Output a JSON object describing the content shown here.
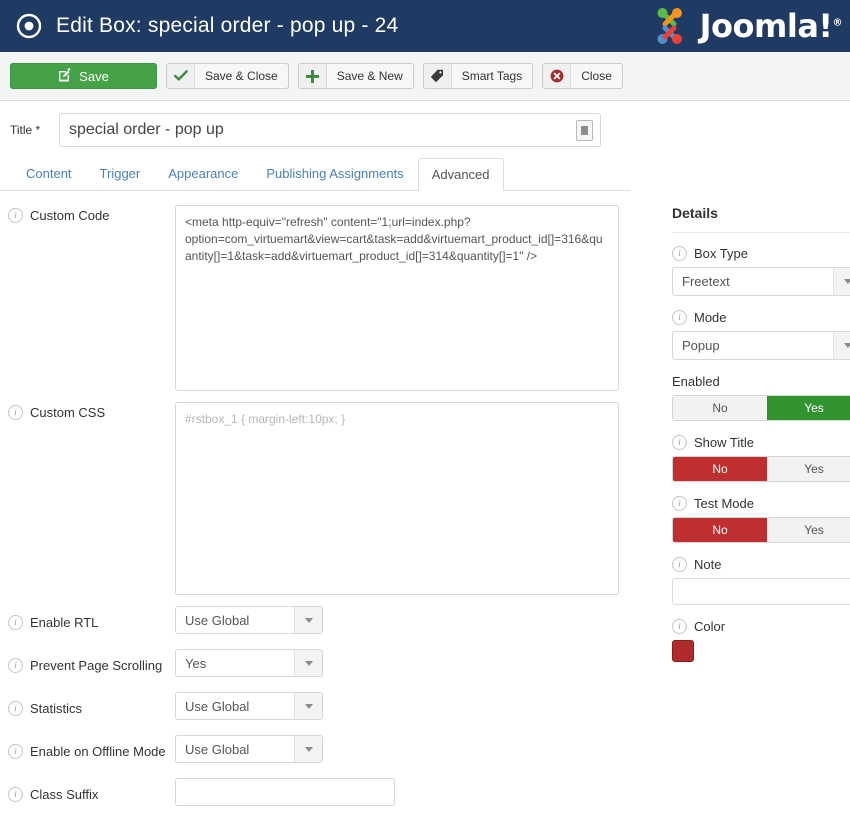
{
  "header": {
    "icon": "target-icon",
    "title": "Edit Box: special order - pop up - 24",
    "brand": "Joomla!",
    "brand_reg": "®",
    "bg_color": "#1f3a63"
  },
  "toolbar": {
    "buttons": [
      {
        "label": "Save",
        "icon": "pencil-square-icon",
        "style": "primary-green"
      },
      {
        "label": "Save & Close",
        "icon": "check-icon",
        "style": "default"
      },
      {
        "label": "Save & New",
        "icon": "plus-icon",
        "style": "default"
      },
      {
        "label": "Smart Tags",
        "icon": "tag-icon",
        "style": "default"
      },
      {
        "label": "Close",
        "icon": "circle-x-icon",
        "style": "default"
      }
    ]
  },
  "title_field": {
    "label": "Title *",
    "value": "special order - pop up",
    "placeholder": "",
    "badge_icon": "article-badge-icon"
  },
  "tabs": [
    {
      "label": "Content",
      "active": false
    },
    {
      "label": "Trigger",
      "active": false
    },
    {
      "label": "Appearance",
      "active": false
    },
    {
      "label": "Publishing Assignments",
      "active": false
    },
    {
      "label": "Advanced",
      "active": true
    }
  ],
  "main": {
    "custom_code": {
      "label": "Custom Code",
      "value": "<meta http-equiv=\"refresh\" content=\"1;url=index.php?option=com_virtuemart&view=cart&task=add&virtuemart_product_id[]=316&quantity[]=1&task=add&virtuemart_product_id[]=314&quantity[]=1\" />",
      "placeholder": ""
    },
    "custom_css": {
      "label": "Custom CSS",
      "value": "",
      "placeholder": "#rstbox_1 { margin-left:10px; }"
    },
    "selects": [
      {
        "label": "Enable RTL",
        "value": "Use Global"
      },
      {
        "label": "Prevent Page Scrolling",
        "value": "Yes"
      },
      {
        "label": "Statistics",
        "value": "Use Global"
      },
      {
        "label": "Enable on Offline Mode",
        "value": "Use Global"
      }
    ],
    "class_suffix": {
      "label": "Class Suffix",
      "value": "",
      "placeholder": ""
    }
  },
  "details": {
    "title": "Details",
    "box_type": {
      "label": "Box Type",
      "value": "Freetext"
    },
    "mode": {
      "label": "Mode",
      "value": "Popup"
    },
    "enabled": {
      "label": "Enabled",
      "no": "No",
      "yes": "Yes",
      "selected": "yes"
    },
    "show_title": {
      "label": "Show Title",
      "no": "No",
      "yes": "Yes",
      "selected": "no"
    },
    "test_mode": {
      "label": "Test Mode",
      "no": "No",
      "yes": "Yes",
      "selected": "no"
    },
    "note": {
      "label": "Note",
      "value": "",
      "placeholder": ""
    },
    "color": {
      "label": "Color",
      "value": "#b02b2b"
    }
  },
  "icons": {
    "info": "i"
  }
}
